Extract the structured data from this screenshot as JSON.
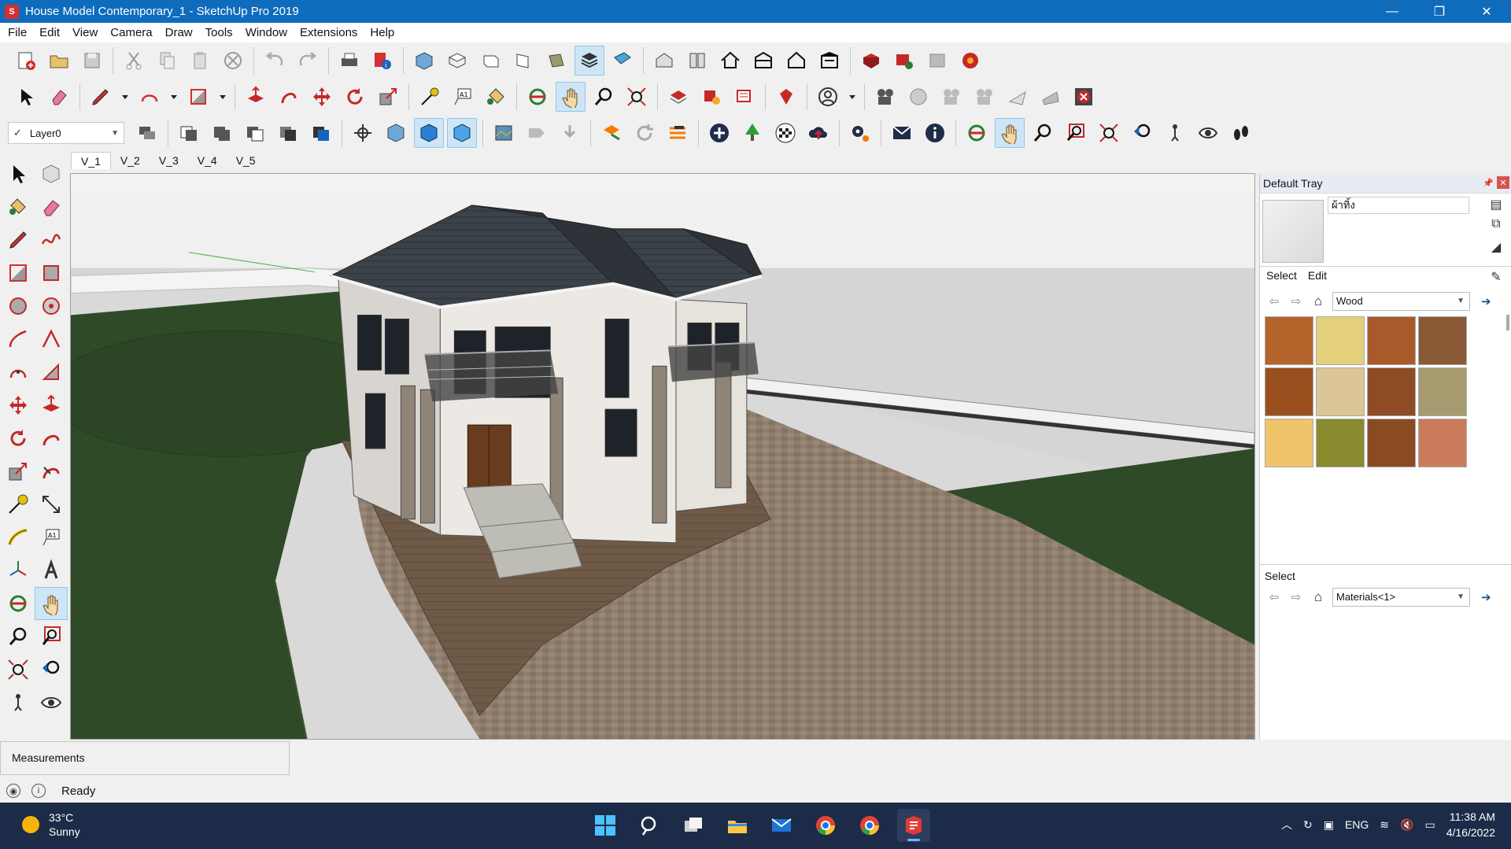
{
  "window": {
    "title": "House Model Contemporary_1 - SketchUp Pro 2019",
    "minimize_glyph": "—",
    "maximize_glyph": "❐",
    "close_glyph": "✕"
  },
  "menu": [
    "File",
    "Edit",
    "View",
    "Camera",
    "Draw",
    "Tools",
    "Window",
    "Extensions",
    "Help"
  ],
  "toolbar": {
    "layer_value": "Layer0",
    "layer_check": "✓"
  },
  "scene_tabs": [
    "V_1",
    "V_2",
    "V_3",
    "V_4",
    "V_5"
  ],
  "tray": {
    "title": "Default Tray",
    "material_name": "ผ้าทิ้ง",
    "tabs": [
      "Select",
      "Edit"
    ],
    "library": "Wood",
    "section2_label": "Select",
    "library2": "Materials<1>",
    "swatches": [
      "#b5642b",
      "#e4d07a",
      "#a95a2a",
      "#8a5a36",
      "#9a4f1e",
      "#dcc596",
      "#8f4c24",
      "#a69b6e",
      "#f0c46a",
      "#8a8a2e",
      "#8a4a22",
      "#c97b5a"
    ]
  },
  "measurements": {
    "label": "Measurements"
  },
  "status": {
    "text": "Ready"
  },
  "taskbar": {
    "temp": "33°C",
    "weather": "Sunny",
    "lang": "ENG",
    "time": "11:38 AM",
    "date": "4/16/2022"
  },
  "colors": {
    "titlebar": "#0f6cbd",
    "taskbar": "#1c2b48",
    "grass": "#2f4a26",
    "pavement": "#8c7b6a",
    "roof": "#3a4148"
  }
}
